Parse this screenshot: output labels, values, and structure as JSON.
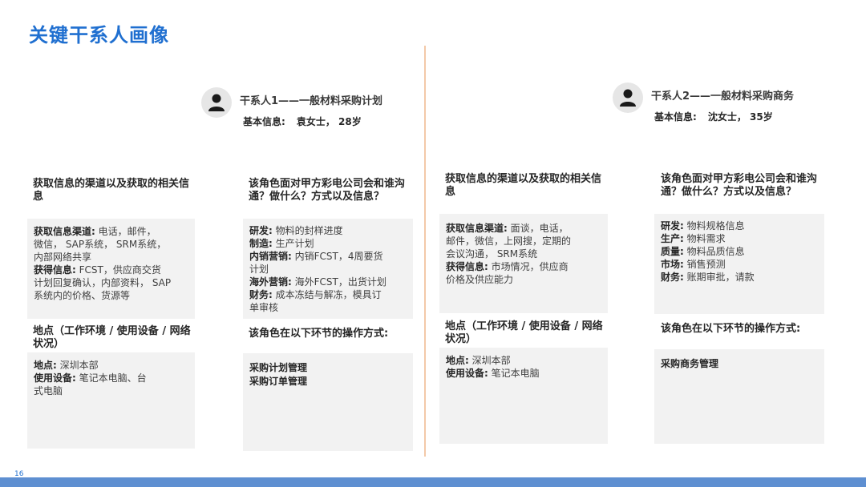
{
  "title": "关键干系人画像",
  "page_number": "16",
  "colors": {
    "accent": "#1f6fd0",
    "divider": "#f3c9a8",
    "box_bg": "#f2f2f2",
    "bar": "#5e8fd1"
  },
  "stakeholders": [
    {
      "avatar_icon": "person-icon",
      "name": "干系人1——一般材料采购计划",
      "info_label": "基本信息:",
      "info_value": "袁女士， 28岁",
      "channel_heading": "获取信息的渠道以及获取的相关信息",
      "channel_box": [
        {
          "label": "获取信息渠道:",
          "text": "   电话，邮件，"
        },
        {
          "label": "",
          "text": "微信， SAP系统， SRM系统，"
        },
        {
          "label": "",
          "text": "内部网络共享"
        },
        {
          "label": "获得信息:",
          "text": "   FCST，供应商交货"
        },
        {
          "label": "",
          "text": "计划回复确认，内部资料，   SAP"
        },
        {
          "label": "",
          "text": "系统内的价格、货源等"
        }
      ],
      "contact_heading": "该角色面对甲方彩电公司会和谁沟通？做什么？方式以及信息？",
      "contact_box": [
        {
          "label": "研发:",
          "text": "   物料的封样进度"
        },
        {
          "label": "制造:",
          "text": "   生产计划"
        },
        {
          "label": "内销营销:",
          "text": "   内销FCST，4周要货"
        },
        {
          "label": "",
          "text": "计划"
        },
        {
          "label": "海外营销:",
          "text": "   海外FCST，出货计划"
        },
        {
          "label": "财务:",
          "text": "   成本冻结与解冻，模具订"
        },
        {
          "label": "",
          "text": "单审核"
        }
      ],
      "location_heading": "地点（工作环境 / 使用设备 / 网络状况）",
      "location_box": [
        {
          "label": "地点:",
          "text": "   深圳本部"
        },
        {
          "label": "使用设备:",
          "text": "   笔记本电脑、台"
        },
        {
          "label": "",
          "text": "式电脑"
        }
      ],
      "ops_heading": "该角色在以下环节的操作方式:",
      "ops_box": [
        "采购计划管理",
        "采购订单管理"
      ]
    },
    {
      "avatar_icon": "person-icon",
      "name": "干系人2——一般材料采购商务",
      "info_label": "基本信息:",
      "info_value": "沈女士， 35岁",
      "channel_heading": "获取信息的渠道以及获取的相关信息",
      "channel_box": [
        {
          "label": "获取信息渠道:",
          "text": "   面谈，电话，"
        },
        {
          "label": "",
          "text": "邮件，微信，上网搜，定期的"
        },
        {
          "label": "",
          "text": "会议沟通，   SRM系统"
        },
        {
          "label": "获得信息:",
          "text": "   市场情况，供应商"
        },
        {
          "label": "",
          "text": "价格及供应能力"
        }
      ],
      "contact_heading": "该角色面对甲方彩电公司会和谁沟通？做什么？方式以及信息？",
      "contact_box": [
        {
          "label": "研发:",
          "text": "   物料规格信息"
        },
        {
          "label": "生产:",
          "text": "   物料需求"
        },
        {
          "label": "质量:",
          "text": "   物料品质信息"
        },
        {
          "label": "市场:",
          "text": "   销售预测"
        },
        {
          "label": "财务:",
          "text": "   账期审批，请款"
        }
      ],
      "location_heading": "地点（工作环境 / 使用设备 / 网络状况）",
      "location_box": [
        {
          "label": "地点:",
          "text": "   深圳本部"
        },
        {
          "label": "使用设备:",
          "text": "   笔记本电脑"
        }
      ],
      "ops_heading": "该角色在以下环节的操作方式:",
      "ops_box": [
        "采购商务管理"
      ]
    }
  ]
}
